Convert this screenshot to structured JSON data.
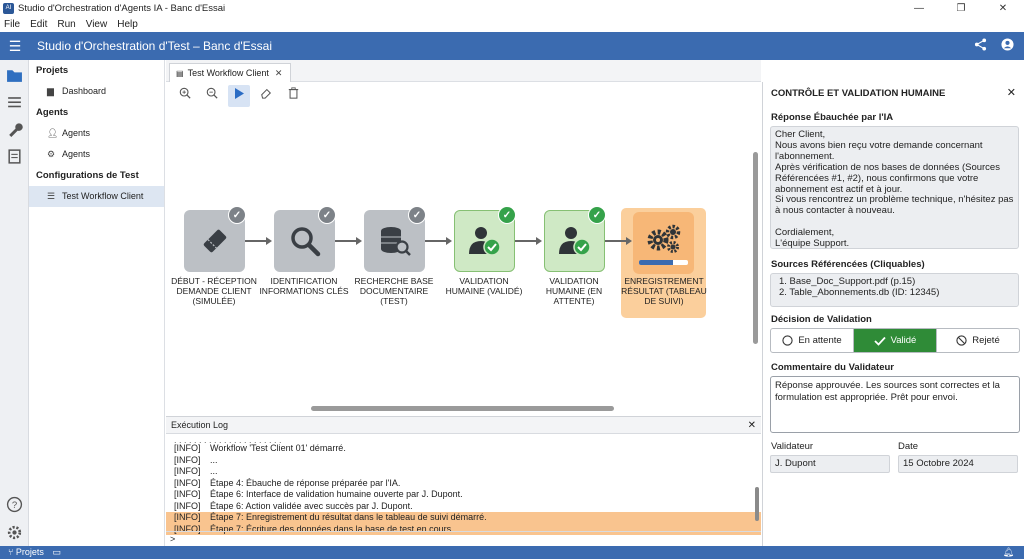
{
  "window": {
    "title": "Studio d'Orchestration d'Agents IA - Banc d'Essai",
    "app_icon": "AI",
    "minimize": "—",
    "maximize": "❐",
    "close": "✕"
  },
  "menu": [
    "File",
    "Edit",
    "Run",
    "View",
    "Help"
  ],
  "appbar": {
    "title": "Studio d'Orchestration d'Test – Banc d'Essai",
    "share_icon": "share-icon",
    "user_icon": "account-icon"
  },
  "sidebar": {
    "sections": [
      {
        "label": "Projets",
        "items": [
          {
            "label": "Dashboard",
            "icon": "folder-icon"
          }
        ]
      },
      {
        "label": "Agents",
        "items": [
          {
            "label": "Agents",
            "icon": "person-icon"
          },
          {
            "label": "Agents",
            "icon": "gear-icon"
          }
        ]
      },
      {
        "label": "Configurations de Test",
        "items": [
          {
            "label": "Test Workflow Client",
            "icon": "list-icon",
            "active": true
          }
        ]
      }
    ]
  },
  "editor": {
    "tab_label": "Test Workflow Client"
  },
  "workflow": {
    "nodes": [
      {
        "label": "DÉBUT - RÉCEPTION DEMANDE CLIENT (SIMULÉE)",
        "icon": "ticket-icon",
        "state": "done"
      },
      {
        "label": "IDENTIFICATION INFORMATIONS CLÉS",
        "icon": "search-icon",
        "state": "done"
      },
      {
        "label": "RECHERCHE BASE DOCUMENTAIRE (TEST)",
        "icon": "database-search-icon",
        "state": "done"
      },
      {
        "label": "VALIDATION HUMAINE (VALIDÉ)",
        "icon": "user-check-icon",
        "state": "validated"
      },
      {
        "label": "VALIDATION HUMAINE (EN ATTENTE)",
        "icon": "user-check-icon",
        "state": "validated"
      },
      {
        "label": "ENREGISTREMENT RÉSULTAT (TABLEAU DE SUIVI)",
        "icon": "gears-icon",
        "state": "running",
        "progress": 0.7
      }
    ]
  },
  "log": {
    "title": "Exécution Log",
    "lines": [
      {
        "tag": "[INFO]",
        "text": "Workflow 'Test Client 01' démarré.",
        "highlight": false
      },
      {
        "tag": "[INFO]",
        "text": "...",
        "highlight": false
      },
      {
        "tag": "[INFO]",
        "text": "...",
        "highlight": false
      },
      {
        "tag": "[INFO]",
        "text": "Étape 4: Ébauche de réponse préparée par l'IA.",
        "highlight": false
      },
      {
        "tag": "[INFO]",
        "text": "Étape 6: Interface de validation humaine ouverte par J. Dupont.",
        "highlight": false
      },
      {
        "tag": "[INFO]",
        "text": "Étape 6: Action validée avec succès par J. Dupont.",
        "highlight": false
      },
      {
        "tag": "[INFO]",
        "text": "Étape 7: Enregistrement du résultat dans le tableau de suivi démarré.",
        "highlight": true
      },
      {
        "tag": "[INFO]",
        "text": "Étape 7: Écriture des données dans la base de test en cours.",
        "highlight": true
      }
    ],
    "prompt": ">"
  },
  "review": {
    "title": "CONTRÔLE ET VALIDATION HUMAINE",
    "draft_label": "Réponse Ébauchée par l'IA",
    "draft_text": "Cher Client,\nNous avons bien reçu votre demande concernant l'abonnement.\nAprès vérification de nos bases de données (Sources Référencées #1, #2), nous confirmons que votre abonnement est actif et à jour.\nSi vous rencontrez un problème technique, n'hésitez pas à nous contacter à nouveau.\n\nCordialement,\nL'équipe Support.",
    "sources_label": "Sources Référencées (Cliquables)",
    "sources": [
      "1. Base_Doc_Support.pdf (p.15)",
      "2. Table_Abonnements.db (ID: 12345)"
    ],
    "decision_label": "Décision de Validation",
    "decision_options": [
      "En attente",
      "Validé",
      "Rejeté"
    ],
    "decision_selected": "Validé",
    "comment_label": "Commentaire du Validateur",
    "comment_text": "Réponse approuvée. Les sources sont correctes et la formulation est appropriée. Prêt pour envoi.",
    "validator_label": "Validateur",
    "validator_value": "J. Dupont",
    "date_label": "Date",
    "date_value": "15 Octobre 2024"
  },
  "status": {
    "left": "Projets"
  },
  "colors": {
    "accent": "#3b6bb0",
    "success": "#2f8b37",
    "highlight": "#f9c48f"
  }
}
